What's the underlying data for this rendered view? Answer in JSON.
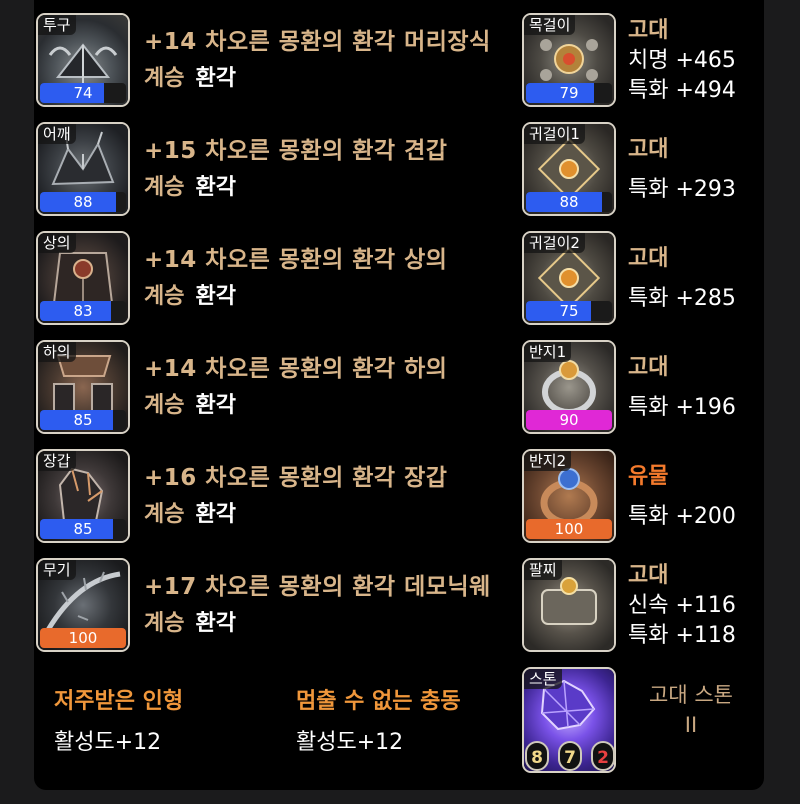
{
  "equipment": [
    {
      "slot": "투구",
      "quality": 74,
      "quality_color": "#2d5cf0",
      "name": "+14 차오른 몽환의 환각 머리장식",
      "tier_label": "계승",
      "tier_value": "환각"
    },
    {
      "slot": "어깨",
      "quality": 88,
      "quality_color": "#2d5cf0",
      "name": "+15 차오른 몽환의 환각 견갑",
      "tier_label": "계승",
      "tier_value": "환각"
    },
    {
      "slot": "상의",
      "quality": 83,
      "quality_color": "#2d5cf0",
      "name": "+14 차오른 몽환의 환각 상의",
      "tier_label": "계승",
      "tier_value": "환각"
    },
    {
      "slot": "하의",
      "quality": 85,
      "quality_color": "#2d5cf0",
      "name": "+14 차오른 몽환의 환각 하의",
      "tier_label": "계승",
      "tier_value": "환각"
    },
    {
      "slot": "장갑",
      "quality": 85,
      "quality_color": "#2d5cf0",
      "name": "+16 차오른 몽환의 환각 장갑",
      "tier_label": "계승",
      "tier_value": "환각"
    },
    {
      "slot": "무기",
      "quality": 100,
      "quality_color": "#e86a2c",
      "name": "+17 차오른 몽환의 환각 데모닉웨",
      "tier_label": "계승",
      "tier_value": "환각"
    }
  ],
  "accessories": [
    {
      "slot": "목걸이",
      "quality": 79,
      "quality_color": "#2d5cf0",
      "grade": "고대",
      "stats": [
        "치명 +465",
        "특화 +494"
      ]
    },
    {
      "slot": "귀걸이1",
      "quality": 88,
      "quality_color": "#2d5cf0",
      "grade": "고대",
      "stats": [
        "특화 +293"
      ]
    },
    {
      "slot": "귀걸이2",
      "quality": 75,
      "quality_color": "#2d5cf0",
      "grade": "고대",
      "stats": [
        "특화 +285"
      ]
    },
    {
      "slot": "반지1",
      "quality": 90,
      "quality_color": "#e028d6",
      "grade": "고대",
      "stats": [
        "특화 +196"
      ]
    },
    {
      "slot": "반지2",
      "quality": 100,
      "quality_color": "#e86a2c",
      "grade": "유물",
      "stats": [
        "특화 +200"
      ]
    },
    {
      "slot": "팔찌",
      "grade": "고대",
      "stats": [
        "신속 +116",
        "특화 +118"
      ]
    }
  ],
  "engravings": [
    {
      "name": "저주받은 인형",
      "value": "활성도+12"
    },
    {
      "name": "멈출 수 없는 충동",
      "value": "활성도+12"
    }
  ],
  "stone": {
    "slot": "스톤",
    "caption_line1": "고대 스톤",
    "caption_line2": "II",
    "gems": [
      {
        "value": "8",
        "color": "#f1d88a"
      },
      {
        "value": "7",
        "color": "#f1d88a"
      },
      {
        "value": "2",
        "color": "#e84040"
      }
    ]
  }
}
